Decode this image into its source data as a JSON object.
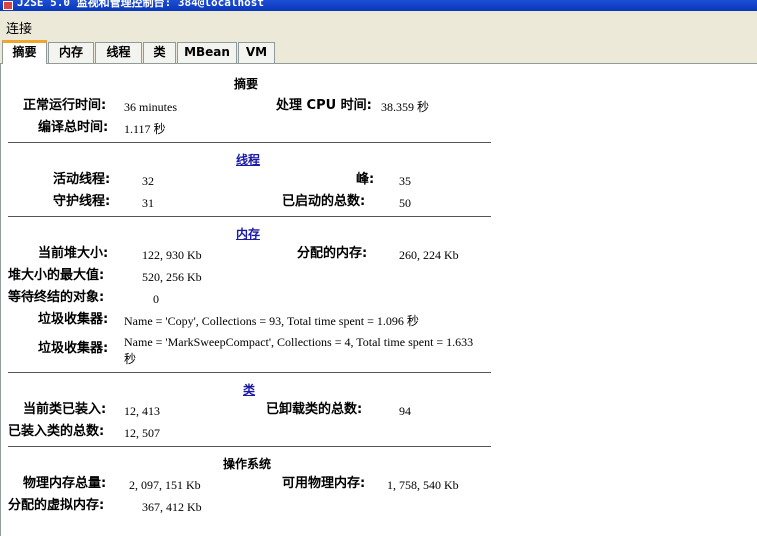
{
  "window": {
    "title": "J2SE 5.0 监视和管理控制台: 384@localhost"
  },
  "menubar": {
    "items": [
      "连接"
    ]
  },
  "tabs": [
    "摘要",
    "内存",
    "线程",
    "类",
    "MBean",
    "VM"
  ],
  "summary": {
    "header": "摘要",
    "uptime_label": "正常运行时间:",
    "uptime_value": "36 minutes",
    "cpu_label": "处理 CPU 时间:",
    "cpu_value": "38.359 秒",
    "compile_label": "编译总时间:",
    "compile_value": "1.117 秒"
  },
  "threads": {
    "header": "线程",
    "live_label": "活动线程:",
    "live_value": "32",
    "peak_label": "峰:",
    "peak_value": "35",
    "daemon_label": "守护线程:",
    "daemon_value": "31",
    "started_label": "已启动的总数:",
    "started_value": "50"
  },
  "memory": {
    "header": "内存",
    "heap_label": "当前堆大小:",
    "heap_value": "122, 930 Kb",
    "committed_label": "分配的内存:",
    "committed_value": "260, 224 Kb",
    "max_label": "堆大小的最大值:",
    "max_value": "520, 256 Kb",
    "pending_label": "等待终结的对象:",
    "pending_value": "0",
    "gc1_label": "垃圾收集器:",
    "gc1_value": "Name = 'Copy', Collections = 93, Total time spent = 1.096 秒",
    "gc2_label": "垃圾收集器:",
    "gc2_value_line1": "Name = 'MarkSweepCompact', Collections = 4, Total time spent = 1.633",
    "gc2_value_line2": "秒"
  },
  "classes": {
    "header": "类",
    "loaded_label": "当前类已装入:",
    "loaded_value": "12, 413",
    "unloaded_label": "已卸载类的总数:",
    "unloaded_value": "94",
    "total_label": "已装入类的总数:",
    "total_value": "12, 507"
  },
  "os": {
    "header": "操作系统",
    "phys_label": "物理内存总量:",
    "phys_value": "2, 097, 151 Kb",
    "free_label": "可用物理内存:",
    "free_value": "1, 758, 540 Kb",
    "virt_label": "分配的虚拟内存:",
    "virt_value": "367, 412 Kb"
  }
}
